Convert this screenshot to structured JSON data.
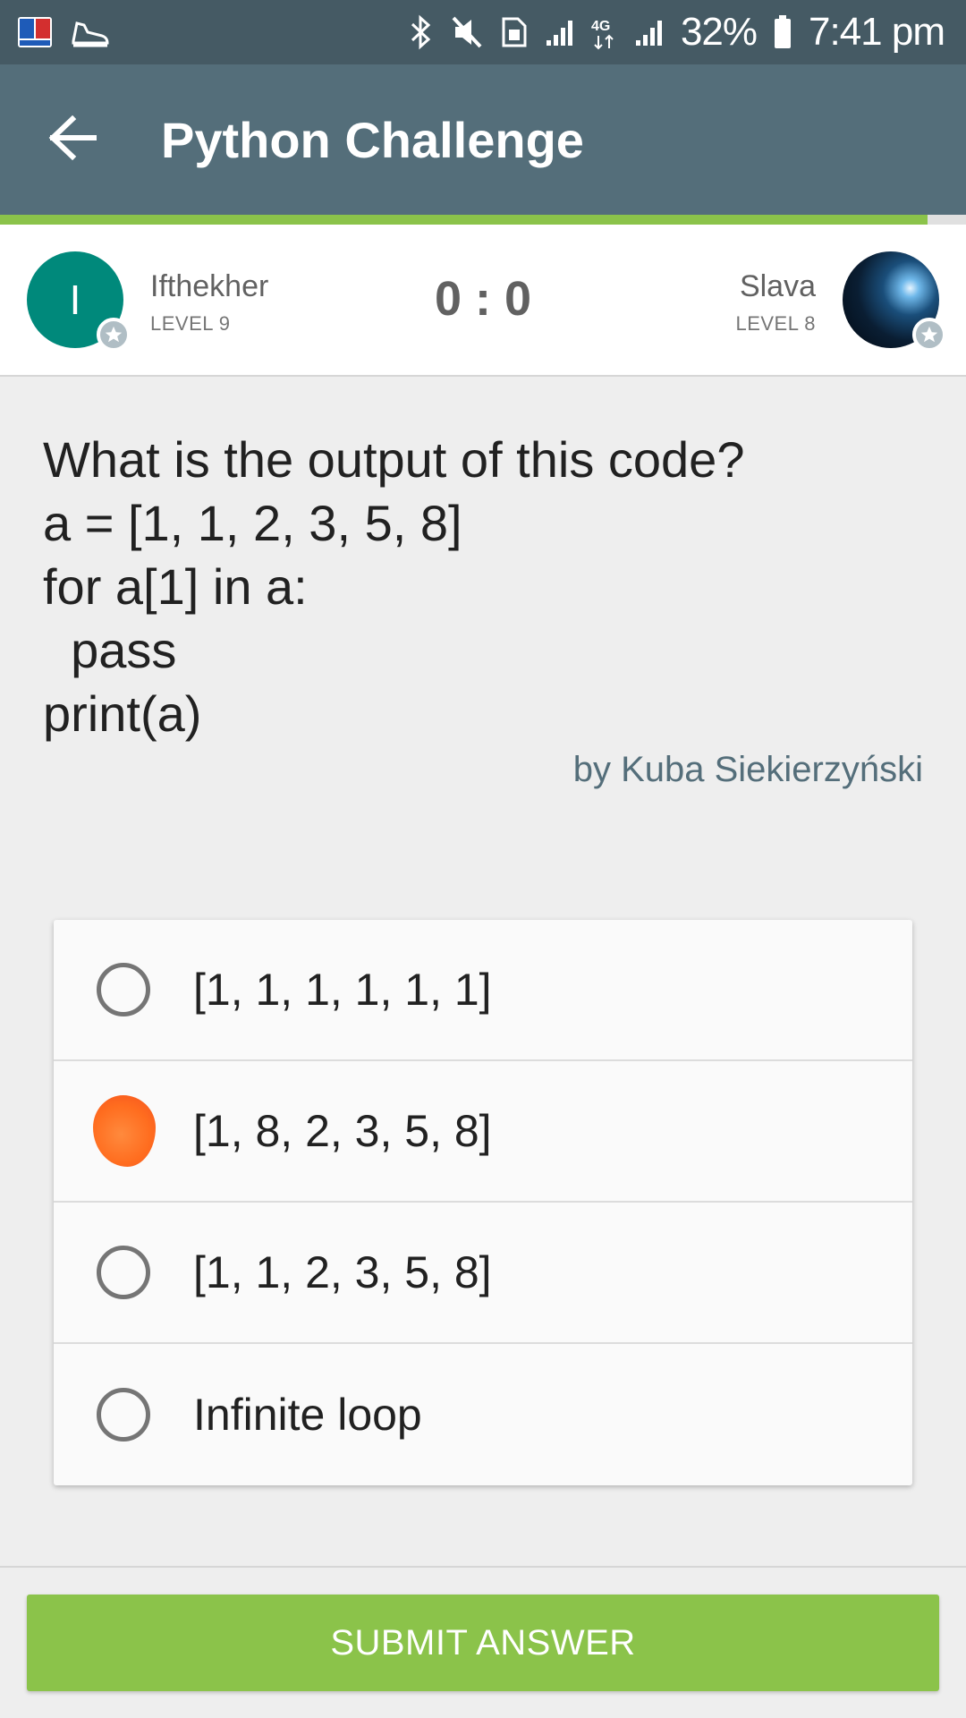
{
  "status_bar": {
    "battery": "32%",
    "time": "7:41 pm",
    "icons": [
      "dictionary-app-icon",
      "shoe-icon",
      "bluetooth-icon",
      "mute-icon",
      "sim-icon",
      "signal-icon",
      "4g-icon",
      "signal-icon",
      "battery-icon"
    ]
  },
  "toolbar": {
    "title": "Python Challenge",
    "back_icon": "arrow-left-icon"
  },
  "progress": {
    "value": 0.96,
    "color": "#8bc34a"
  },
  "players": {
    "left": {
      "name": "Ifthekher",
      "level": "LEVEL 9",
      "initial": "I",
      "avatar_color": "#00897b"
    },
    "right": {
      "name": "Slava",
      "level": "LEVEL 8"
    },
    "score": "0 : 0"
  },
  "question": {
    "text": "What is the output of this code?\na = [1, 1, 2, 3, 5, 8]\nfor a[1] in a:\n  pass\nprint(a)",
    "author": "by Kuba Siekierzyński"
  },
  "options": [
    {
      "text": "[1, 1, 1, 1, 1, 1]",
      "selected": false
    },
    {
      "text": "[1, 8, 2, 3, 5, 8]",
      "selected": true
    },
    {
      "text": "[1, 1, 2, 3, 5, 8]",
      "selected": false
    },
    {
      "text": "Infinite loop",
      "selected": false
    }
  ],
  "submit": {
    "label": "SUBMIT ANSWER",
    "color": "#8bc34a"
  },
  "colors": {
    "status_bar": "#455a64",
    "toolbar": "#546e7a",
    "background": "#eeeeee",
    "accent_orange": "#ff6d1f"
  }
}
